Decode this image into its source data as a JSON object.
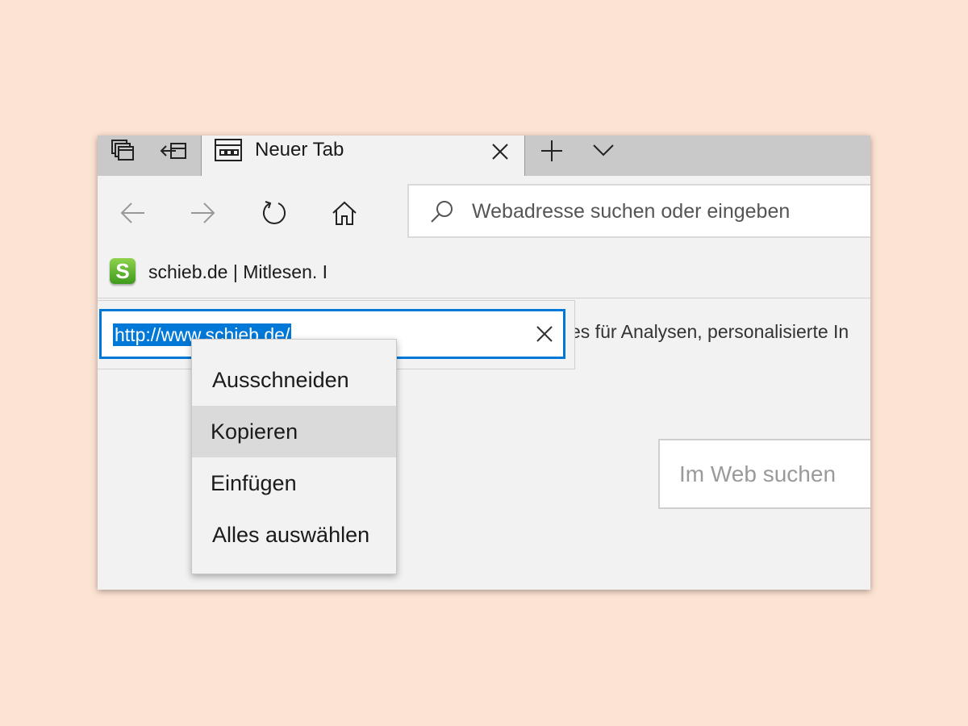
{
  "tabstrip": {
    "tab_title": "Neuer Tab"
  },
  "addressbar": {
    "placeholder": "Webadresse suchen oder eingeben"
  },
  "favorites": {
    "favicon_letter": "S",
    "item_label": "schieb.de | Mitlesen. I"
  },
  "rename": {
    "value": "http://www.schieb.de/"
  },
  "page": {
    "partial_text": "es für Analysen, personalisierte In",
    "search_placeholder": "Im Web suchen"
  },
  "context_menu": {
    "items": [
      {
        "label": "Ausschneiden"
      },
      {
        "label": "Kopieren"
      },
      {
        "label": "Einfügen"
      },
      {
        "label": "Alles auswählen"
      }
    ]
  },
  "colors": {
    "accent": "#0078d7",
    "background": "#fde3d3"
  }
}
